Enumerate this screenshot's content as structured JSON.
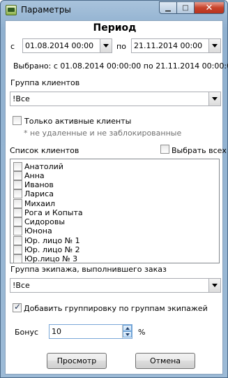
{
  "window": {
    "title": "Параметры"
  },
  "period": {
    "heading": "Период",
    "from_label": "с",
    "from_value": "01.08.2014 00:00",
    "to_label": "по",
    "to_value": "21.11.2014 00:00",
    "selected_text": "Выбрано: с 01.08.2014 00:00:00 по 21.11.2014 00:00:00"
  },
  "client_group": {
    "label": "Группа клиентов",
    "value": "!Все"
  },
  "active_only": {
    "label": "Только активные клиенты",
    "checked": false,
    "hint": "* не удаленные и не заблокированные"
  },
  "client_list": {
    "label": "Список клиентов",
    "select_all_label": "Выбрать всех",
    "items": [
      {
        "label": "Анатолий",
        "checked": false
      },
      {
        "label": "Анна",
        "checked": false
      },
      {
        "label": "Иванов",
        "checked": false
      },
      {
        "label": "Лариса",
        "checked": false
      },
      {
        "label": "Михаил",
        "checked": false
      },
      {
        "label": "Рога и Копыта",
        "checked": false
      },
      {
        "label": "Сидоровы",
        "checked": false
      },
      {
        "label": "Юнона",
        "checked": false
      },
      {
        "label": "Юр. лицо № 1",
        "checked": false
      },
      {
        "label": "Юр. лицо № 2",
        "checked": false
      },
      {
        "label": "Юр.лицо № 3",
        "checked": false
      }
    ]
  },
  "crew_group": {
    "label": "Группа экипажа, выполнившего заказ",
    "value": "!Все"
  },
  "group_by_crew": {
    "label": "Добавить группировку по группам экипажей",
    "checked": true
  },
  "bonus": {
    "label": "Бонус",
    "value": "10",
    "unit": "%"
  },
  "buttons": {
    "preview": "Просмотр",
    "cancel": "Отмена"
  }
}
